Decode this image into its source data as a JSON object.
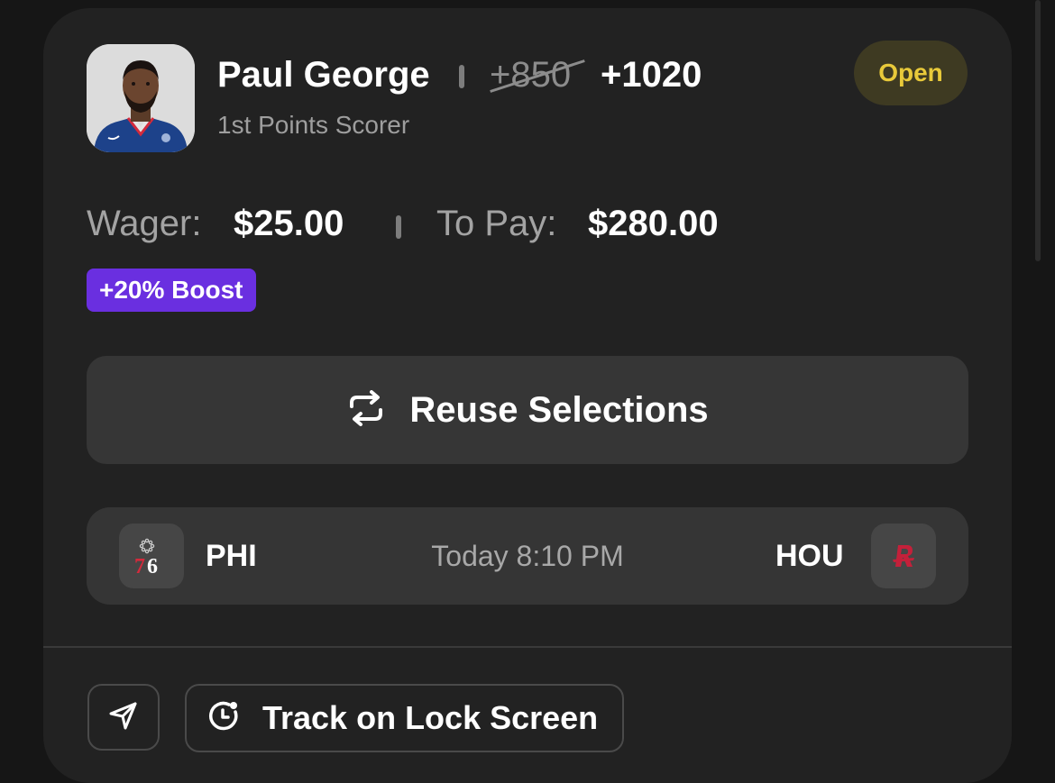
{
  "bet": {
    "player_name": "Paul George",
    "odds_original": "+850",
    "odds_boosted": "+1020",
    "market": "1st Points Scorer",
    "status": "Open",
    "wager_label": "Wager:",
    "wager_value": "$25.00",
    "to_pay_label": "To Pay:",
    "to_pay_value": "$280.00",
    "boost": "+20% Boost"
  },
  "actions": {
    "reuse_label": "Reuse Selections",
    "track_label": "Track on Lock Screen",
    "share_icon": "send-icon",
    "reuse_icon": "repeat-icon",
    "track_icon": "live-activity-icon"
  },
  "game": {
    "home_abbr": "PHI",
    "away_abbr": "HOU",
    "time": "Today 8:10 PM",
    "home_logo": "76ers-logo",
    "away_logo": "rockets-logo"
  },
  "colors": {
    "card_bg": "#222222",
    "status_open_text": "#e8c93a",
    "status_open_bg": "#3e3a22",
    "boost_bg": "#6a2fe0",
    "sixers_red": "#d42a3c",
    "sixers_blue": "#1d428a",
    "rockets_red": "#c4203a"
  }
}
